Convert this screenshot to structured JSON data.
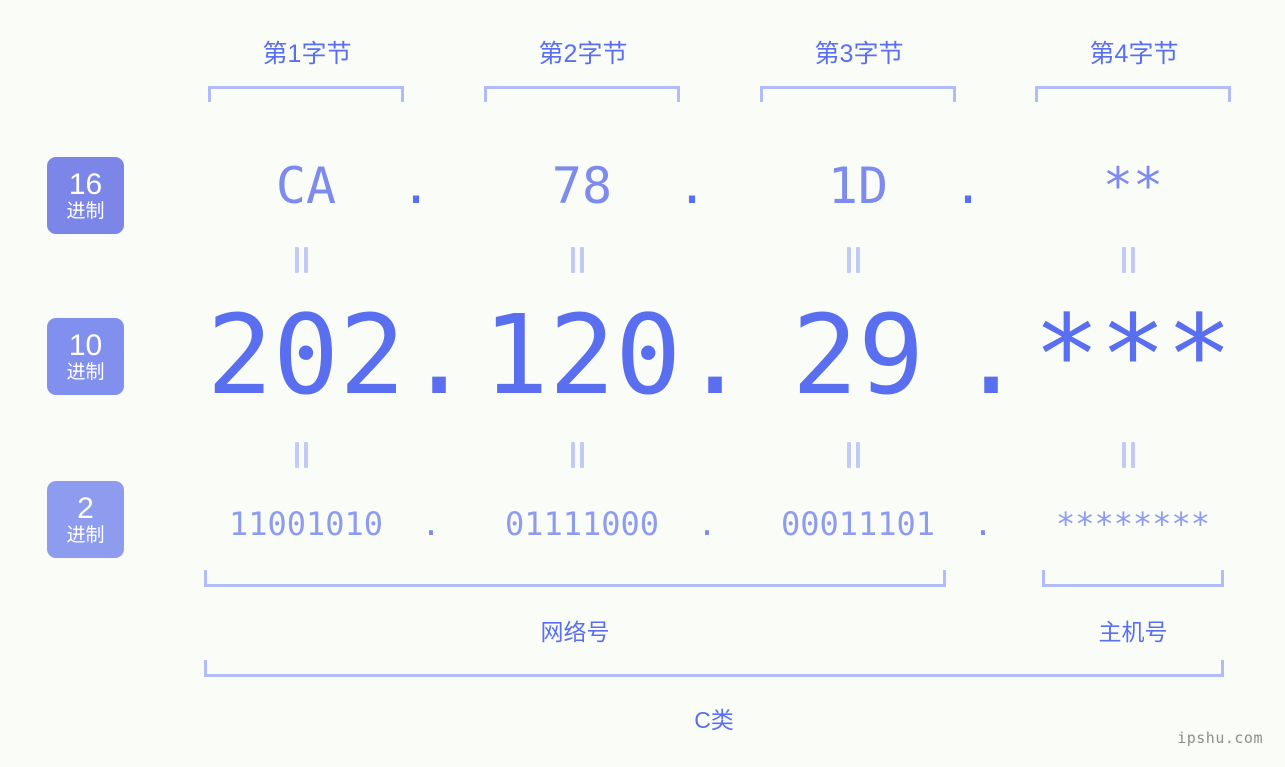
{
  "meta": {
    "background_color": "#fafcf8",
    "accent_color": "#5a6ff0",
    "accent_light": "#8e9cf0",
    "bracket_color": "#b3bcfa",
    "watermark": "ipshu.com"
  },
  "byte_headers": [
    {
      "label": "第1字节"
    },
    {
      "label": "第2字节"
    },
    {
      "label": "第3字节"
    },
    {
      "label": "第4字节"
    }
  ],
  "rows": [
    {
      "key": "hex",
      "badge_number": "16",
      "badge_system": "进制",
      "badge_color": "#7b86e8",
      "separator": ".",
      "values": [
        "CA",
        "78",
        "1D",
        "**"
      ]
    },
    {
      "key": "dec",
      "badge_number": "10",
      "badge_system": "进制",
      "badge_color": "#818fee",
      "separator": ".",
      "values": [
        "202",
        "120",
        "29",
        "***"
      ]
    },
    {
      "key": "bin",
      "badge_number": "2",
      "badge_system": "进制",
      "badge_color": "#8e9cf0",
      "separator": ".",
      "values": [
        "11001010",
        "01111000",
        "00011101",
        "********"
      ]
    }
  ],
  "groups": {
    "network": "网络号",
    "host": "主机号",
    "class": "C类"
  }
}
